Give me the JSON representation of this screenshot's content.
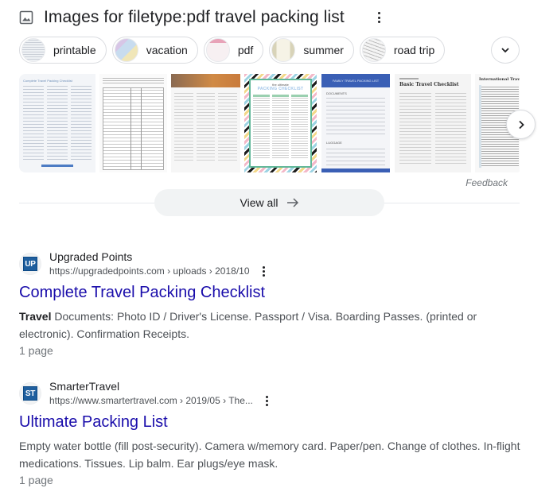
{
  "images_section": {
    "icon": "image-icon",
    "title": "Images for filetype:pdf travel packing list",
    "more_icon": "more-vert-icon",
    "chips": [
      {
        "label": "printable",
        "thumb_tint": "#eef1f4"
      },
      {
        "label": "vacation",
        "thumb_tint": "#c9d6e8"
      },
      {
        "label": "pdf",
        "thumb_tint": "#f3e3e8"
      },
      {
        "label": "summer",
        "thumb_tint": "#efece1"
      },
      {
        "label": "road trip",
        "thumb_tint": "#e9e9e9"
      }
    ],
    "expand_icon": "chevron-down-icon",
    "images": [
      {
        "alt": "Complete Travel Packing Checklist",
        "style": "light-doc",
        "accent": "#6f8fb8"
      },
      {
        "alt": "Travel Packing Checklist table",
        "style": "table-doc",
        "accent": "#555555"
      },
      {
        "alt": "Ultimate packing checklist with banner",
        "style": "banner-doc",
        "accent": "#c9773a"
      },
      {
        "alt": "The Ultimate Packing Checklist",
        "style": "striped-doc",
        "accent": "#62b89a"
      },
      {
        "alt": "Family Travel Packing List",
        "style": "blue-doc",
        "accent": "#3a5fb5"
      },
      {
        "alt": "Basic Travel Checklist",
        "style": "plain-doc",
        "accent": "#444444"
      },
      {
        "alt": "International Travel checklist",
        "style": "list-doc",
        "accent": "#333333"
      }
    ],
    "family_list": {
      "header": "FAMILY TRAVEL PACKING LIST",
      "section1": "DOCUMENTS",
      "section2": "LUGGAGE"
    },
    "basic_list": {
      "header": "Basic Travel Checklist"
    },
    "intl_list": {
      "header": "International Trave"
    },
    "striped": {
      "line1": "the ultimate",
      "line2": "PACKING CHECKLIST"
    },
    "complete": {
      "header": "Complete Travel Packing Checklist"
    },
    "next_icon": "chevron-right-icon",
    "feedback_label": "Feedback",
    "view_all_label": "View all",
    "view_all_icon": "arrow-right-icon"
  },
  "results": [
    {
      "site_name": "Upgraded Points",
      "favicon_text": "UP",
      "url": "https://upgradedpoints.com › uploads › 2018/10",
      "title": "Complete Travel Packing Checklist",
      "snippet_bold": "Travel",
      "snippet": " Documents: Photo ID / Driver's License. Passport / Visa. Boarding Passes. (printed or electronic). Confirmation Receipts.",
      "meta": "1 page"
    },
    {
      "site_name": "SmarterTravel",
      "favicon_text": "ST",
      "url": "https://www.smartertravel.com › 2019/05 › The...",
      "title": "Ultimate Packing List",
      "snippet_bold": "",
      "snippet": "Empty water bottle (fill post-security). Camera w/memory card. Paper/pen. Change of clothes. In-flight medications. Tissues. Lip balm. Ear plugs/eye mask.",
      "meta": "1 page"
    }
  ]
}
